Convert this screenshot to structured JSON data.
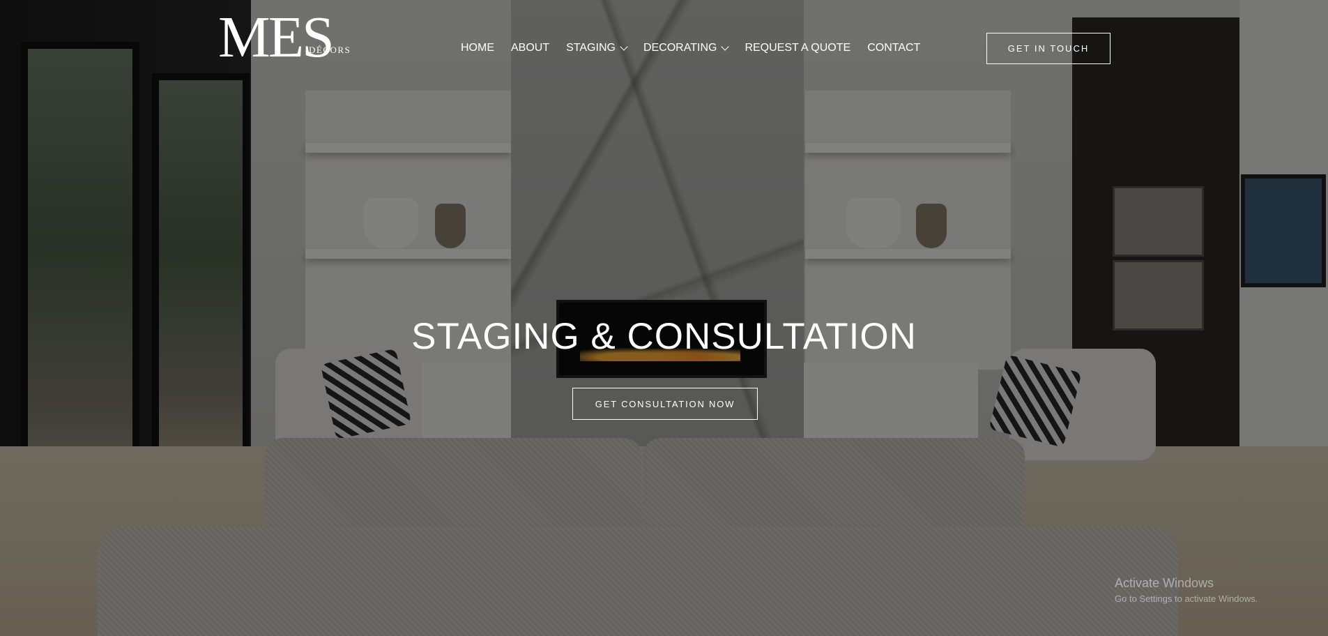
{
  "logo": {
    "main": "MES",
    "sub": "DÉCORS"
  },
  "nav": {
    "items": [
      {
        "label": "HOME"
      },
      {
        "label": "ABOUT"
      },
      {
        "label": "STAGING"
      },
      {
        "label": "DECORATING"
      },
      {
        "label": "REQUEST A QUOTE"
      },
      {
        "label": "CONTACT"
      }
    ]
  },
  "header": {
    "cta_label": "GET IN TOUCH"
  },
  "hero": {
    "title": "STAGING & CONSULTATION",
    "cta_label": "GET CONSULTATION NOW"
  },
  "watermark": {
    "title": "Activate Windows",
    "subtitle": "Go to Settings to activate Windows."
  },
  "colors": {
    "overlay": "#00000080",
    "text": "#ffffff"
  }
}
